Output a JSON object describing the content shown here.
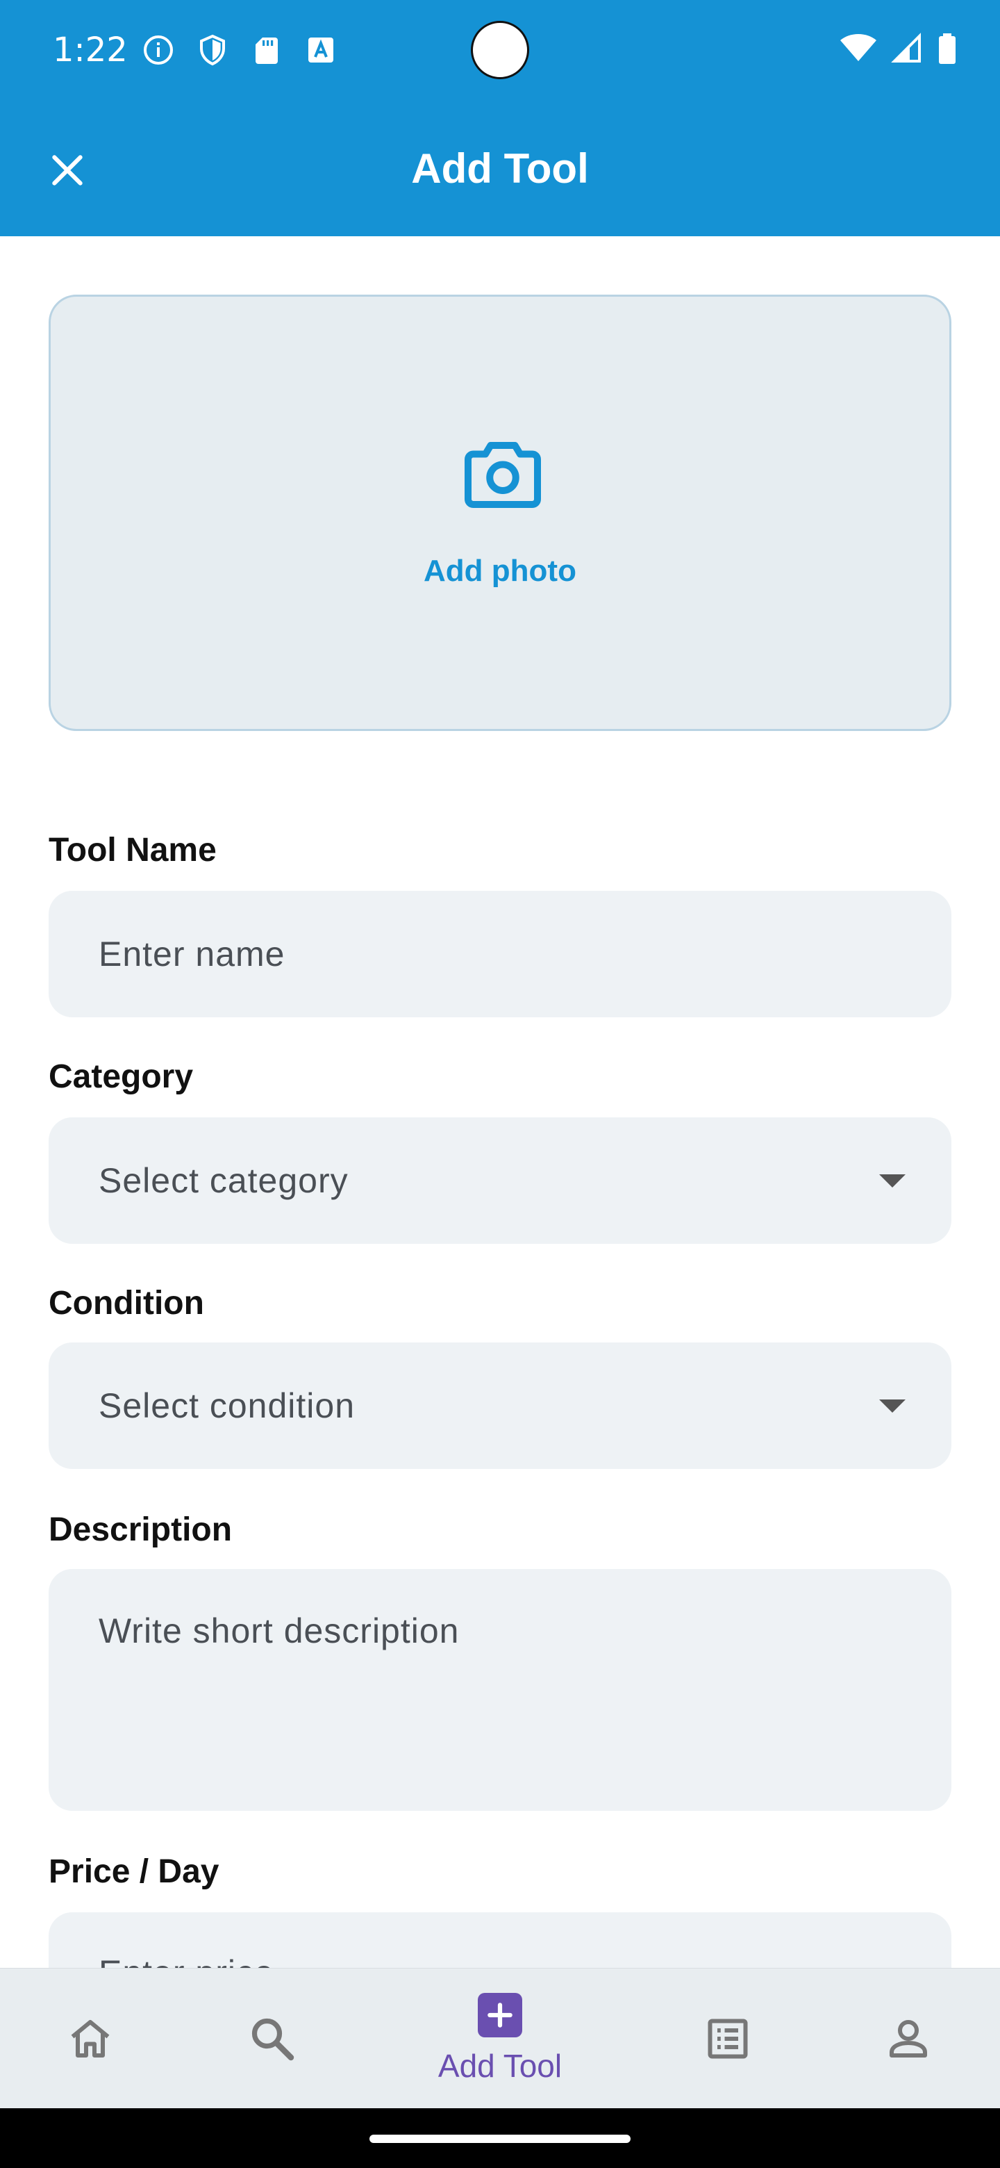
{
  "status_bar": {
    "time": "1:22",
    "left_icons": [
      "info-icon",
      "shield-icon",
      "sd-card-icon",
      "font-a-icon"
    ],
    "right_icons": [
      "wifi-icon",
      "cell-signal-icon",
      "battery-icon"
    ]
  },
  "app_bar": {
    "title": "Add Tool",
    "close_icon": "close-icon",
    "color": "#1592d4"
  },
  "photo": {
    "label": "Add photo",
    "icon": "camera-icon"
  },
  "form": {
    "name": {
      "label": "Tool Name",
      "placeholder": "Enter name"
    },
    "category": {
      "label": "Category",
      "placeholder": "Select category"
    },
    "condition": {
      "label": "Condition",
      "placeholder": "Select condition"
    },
    "description": {
      "label": "Description",
      "placeholder": "Write short description"
    },
    "price": {
      "label": "Price / Day",
      "placeholder": "Enter price"
    }
  },
  "bottom_nav": {
    "items": [
      {
        "icon": "home-icon"
      },
      {
        "icon": "search-icon"
      },
      {
        "icon": "add-box-icon",
        "label": "Add Tool",
        "selected": true
      },
      {
        "icon": "list-icon"
      },
      {
        "icon": "person-icon"
      }
    ],
    "accent": "#6a4fb0"
  }
}
